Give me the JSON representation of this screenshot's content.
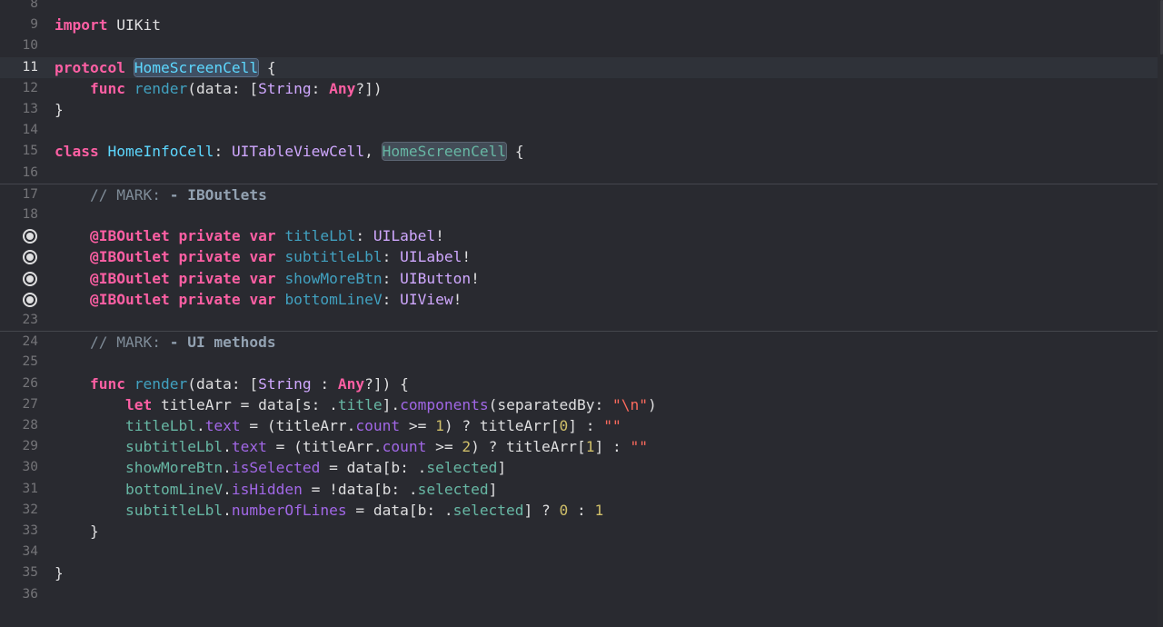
{
  "editor": {
    "lines": [
      {
        "n": "8",
        "tokens": []
      },
      {
        "n": "9",
        "tokens": [
          {
            "t": "import",
            "c": "kw"
          },
          {
            "t": " UIKit",
            "c": ""
          }
        ]
      },
      {
        "n": "10",
        "tokens": []
      },
      {
        "n": "11",
        "current": true,
        "tokens": [
          {
            "t": "protocol",
            "c": "kw"
          },
          {
            "t": " ",
            "c": ""
          },
          {
            "t": "HomeScreenCell",
            "c": "pt hl"
          },
          {
            "t": " {",
            "c": ""
          }
        ]
      },
      {
        "n": "12",
        "tokens": [
          {
            "t": "    ",
            "c": ""
          },
          {
            "t": "func",
            "c": "kw"
          },
          {
            "t": " ",
            "c": ""
          },
          {
            "t": "render",
            "c": "fnc"
          },
          {
            "t": "(data: [",
            "c": ""
          },
          {
            "t": "String",
            "c": "ty"
          },
          {
            "t": ": ",
            "c": ""
          },
          {
            "t": "Any",
            "c": "kw"
          },
          {
            "t": "?])",
            "c": ""
          }
        ]
      },
      {
        "n": "13",
        "tokens": [
          {
            "t": "}",
            "c": ""
          }
        ]
      },
      {
        "n": "14",
        "tokens": []
      },
      {
        "n": "15",
        "tokens": [
          {
            "t": "class",
            "c": "kw"
          },
          {
            "t": " ",
            "c": ""
          },
          {
            "t": "HomeInfoCell",
            "c": "pt"
          },
          {
            "t": ": ",
            "c": ""
          },
          {
            "t": "UITableViewCell",
            "c": "ty"
          },
          {
            "t": ", ",
            "c": ""
          },
          {
            "t": "HomeScreenCell",
            "c": "usr hl2"
          },
          {
            "t": " {",
            "c": ""
          }
        ]
      },
      {
        "n": "16",
        "tokens": []
      },
      {
        "n": "17",
        "sep": true,
        "tokens": [
          {
            "t": "    // MARK: ",
            "c": "cmt"
          },
          {
            "t": "- IBOutlets",
            "c": "mark"
          }
        ]
      },
      {
        "n": "18",
        "tokens": []
      },
      {
        "n": "",
        "bp": true,
        "tokens": [
          {
            "t": "    ",
            "c": ""
          },
          {
            "t": "@IBOutlet",
            "c": "kw"
          },
          {
            "t": " ",
            "c": ""
          },
          {
            "t": "private",
            "c": "kw"
          },
          {
            "t": " ",
            "c": ""
          },
          {
            "t": "var",
            "c": "kw"
          },
          {
            "t": " ",
            "c": ""
          },
          {
            "t": "titleLbl",
            "c": "fnc"
          },
          {
            "t": ": ",
            "c": ""
          },
          {
            "t": "UILabel",
            "c": "ty"
          },
          {
            "t": "!",
            "c": ""
          }
        ]
      },
      {
        "n": "",
        "bp": true,
        "tokens": [
          {
            "t": "    ",
            "c": ""
          },
          {
            "t": "@IBOutlet",
            "c": "kw"
          },
          {
            "t": " ",
            "c": ""
          },
          {
            "t": "private",
            "c": "kw"
          },
          {
            "t": " ",
            "c": ""
          },
          {
            "t": "var",
            "c": "kw"
          },
          {
            "t": " ",
            "c": ""
          },
          {
            "t": "subtitleLbl",
            "c": "fnc"
          },
          {
            "t": ": ",
            "c": ""
          },
          {
            "t": "UILabel",
            "c": "ty"
          },
          {
            "t": "!",
            "c": ""
          }
        ]
      },
      {
        "n": "",
        "bp": true,
        "tokens": [
          {
            "t": "    ",
            "c": ""
          },
          {
            "t": "@IBOutlet",
            "c": "kw"
          },
          {
            "t": " ",
            "c": ""
          },
          {
            "t": "private",
            "c": "kw"
          },
          {
            "t": " ",
            "c": ""
          },
          {
            "t": "var",
            "c": "kw"
          },
          {
            "t": " ",
            "c": ""
          },
          {
            "t": "showMoreBtn",
            "c": "fnc"
          },
          {
            "t": ": ",
            "c": ""
          },
          {
            "t": "UIButton",
            "c": "ty"
          },
          {
            "t": "!",
            "c": ""
          }
        ]
      },
      {
        "n": "",
        "bp": true,
        "tokens": [
          {
            "t": "    ",
            "c": ""
          },
          {
            "t": "@IBOutlet",
            "c": "kw"
          },
          {
            "t": " ",
            "c": ""
          },
          {
            "t": "private",
            "c": "kw"
          },
          {
            "t": " ",
            "c": ""
          },
          {
            "t": "var",
            "c": "kw"
          },
          {
            "t": " ",
            "c": ""
          },
          {
            "t": "bottomLineV",
            "c": "fnc"
          },
          {
            "t": ": ",
            "c": ""
          },
          {
            "t": "UIView",
            "c": "ty"
          },
          {
            "t": "!",
            "c": ""
          }
        ]
      },
      {
        "n": "23",
        "tokens": []
      },
      {
        "n": "24",
        "sep": true,
        "tokens": [
          {
            "t": "    // MARK: ",
            "c": "cmt"
          },
          {
            "t": "- UI methods",
            "c": "mark"
          }
        ]
      },
      {
        "n": "25",
        "tokens": []
      },
      {
        "n": "26",
        "tokens": [
          {
            "t": "    ",
            "c": ""
          },
          {
            "t": "func",
            "c": "kw"
          },
          {
            "t": " ",
            "c": ""
          },
          {
            "t": "render",
            "c": "fnc"
          },
          {
            "t": "(data: [",
            "c": ""
          },
          {
            "t": "String",
            "c": "ty"
          },
          {
            "t": " : ",
            "c": ""
          },
          {
            "t": "Any",
            "c": "kw"
          },
          {
            "t": "?]) {",
            "c": ""
          }
        ]
      },
      {
        "n": "27",
        "tokens": [
          {
            "t": "        ",
            "c": ""
          },
          {
            "t": "let",
            "c": "kw"
          },
          {
            "t": " titleArr = data[s: .",
            "c": ""
          },
          {
            "t": "title",
            "c": "usr"
          },
          {
            "t": "].",
            "c": ""
          },
          {
            "t": "components",
            "c": "prop"
          },
          {
            "t": "(separatedBy: ",
            "c": ""
          },
          {
            "t": "\"\\n\"",
            "c": "str"
          },
          {
            "t": ")",
            "c": ""
          }
        ]
      },
      {
        "n": "28",
        "tokens": [
          {
            "t": "        ",
            "c": ""
          },
          {
            "t": "titleLbl",
            "c": "usr"
          },
          {
            "t": ".",
            "c": ""
          },
          {
            "t": "text",
            "c": "prop"
          },
          {
            "t": " = (titleArr.",
            "c": ""
          },
          {
            "t": "count",
            "c": "prop"
          },
          {
            "t": " >= ",
            "c": ""
          },
          {
            "t": "1",
            "c": "num"
          },
          {
            "t": ") ? titleArr[",
            "c": ""
          },
          {
            "t": "0",
            "c": "num"
          },
          {
            "t": "] : ",
            "c": ""
          },
          {
            "t": "\"\"",
            "c": "str"
          }
        ]
      },
      {
        "n": "29",
        "tokens": [
          {
            "t": "        ",
            "c": ""
          },
          {
            "t": "subtitleLbl",
            "c": "usr"
          },
          {
            "t": ".",
            "c": ""
          },
          {
            "t": "text",
            "c": "prop"
          },
          {
            "t": " = (titleArr.",
            "c": ""
          },
          {
            "t": "count",
            "c": "prop"
          },
          {
            "t": " >= ",
            "c": ""
          },
          {
            "t": "2",
            "c": "num"
          },
          {
            "t": ") ? titleArr[",
            "c": ""
          },
          {
            "t": "1",
            "c": "num"
          },
          {
            "t": "] : ",
            "c": ""
          },
          {
            "t": "\"\"",
            "c": "str"
          }
        ]
      },
      {
        "n": "30",
        "tokens": [
          {
            "t": "        ",
            "c": ""
          },
          {
            "t": "showMoreBtn",
            "c": "usr"
          },
          {
            "t": ".",
            "c": ""
          },
          {
            "t": "isSelected",
            "c": "prop"
          },
          {
            "t": " = data[b: .",
            "c": ""
          },
          {
            "t": "selected",
            "c": "usr"
          },
          {
            "t": "]",
            "c": ""
          }
        ]
      },
      {
        "n": "31",
        "tokens": [
          {
            "t": "        ",
            "c": ""
          },
          {
            "t": "bottomLineV",
            "c": "usr"
          },
          {
            "t": ".",
            "c": ""
          },
          {
            "t": "isHidden",
            "c": "prop"
          },
          {
            "t": " = !data[b: .",
            "c": ""
          },
          {
            "t": "selected",
            "c": "usr"
          },
          {
            "t": "]",
            "c": ""
          }
        ]
      },
      {
        "n": "32",
        "tokens": [
          {
            "t": "        ",
            "c": ""
          },
          {
            "t": "subtitleLbl",
            "c": "usr"
          },
          {
            "t": ".",
            "c": ""
          },
          {
            "t": "numberOfLines",
            "c": "prop"
          },
          {
            "t": " = data[b: .",
            "c": ""
          },
          {
            "t": "selected",
            "c": "usr"
          },
          {
            "t": "] ? ",
            "c": ""
          },
          {
            "t": "0",
            "c": "num"
          },
          {
            "t": " : ",
            "c": ""
          },
          {
            "t": "1",
            "c": "num"
          }
        ]
      },
      {
        "n": "33",
        "tokens": [
          {
            "t": "    }",
            "c": ""
          }
        ]
      },
      {
        "n": "34",
        "tokens": []
      },
      {
        "n": "35",
        "tokens": [
          {
            "t": "}",
            "c": ""
          }
        ]
      },
      {
        "n": "36",
        "tokens": []
      }
    ]
  }
}
